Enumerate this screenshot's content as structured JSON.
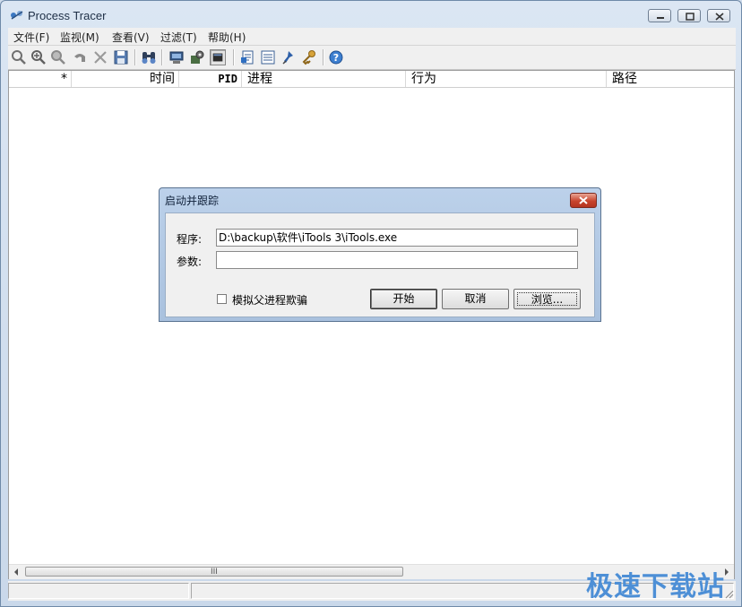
{
  "window": {
    "title": "Process Tracer",
    "icon": "process-tracer-app-icon"
  },
  "menu": [
    {
      "label": "文件(F)"
    },
    {
      "label": "监视(M)"
    },
    {
      "label": "查看(V)"
    },
    {
      "label": "过滤(T)"
    },
    {
      "label": "帮助(H)"
    }
  ],
  "toolbar_icons": [
    "magnifier-icon",
    "zoom-in-icon",
    "zoom-out-icon",
    "undo-icon",
    "delete-icon",
    "save-icon",
    "find-icon",
    "computer-icon",
    "settings-icon",
    "console-icon",
    "export-icon",
    "list-icon",
    "pin-icon",
    "key-icon",
    "help-icon"
  ],
  "columns": [
    {
      "label": "*"
    },
    {
      "label": "时间"
    },
    {
      "label": "PID"
    },
    {
      "label": "进程"
    },
    {
      "label": "行为"
    },
    {
      "label": "路径"
    }
  ],
  "scrollbar": {
    "grip": "III"
  },
  "dialog": {
    "title": "启动并跟踪",
    "program_label": "程序:",
    "program_value": "D:\\backup\\软件\\iTools 3\\iTools.exe",
    "params_label": "参数:",
    "params_value": "",
    "checkbox_label": "模拟父进程欺骗",
    "checkbox_checked": false,
    "start_button": "开始",
    "cancel_button": "取消",
    "browse_button": "浏览..."
  },
  "watermark": "极速下载站",
  "colors": {
    "titlebar": "#cfdcec",
    "dialog_frame": "#bcd1ea",
    "close_button": "#c8442d",
    "watermark": "#4d8fd6"
  }
}
